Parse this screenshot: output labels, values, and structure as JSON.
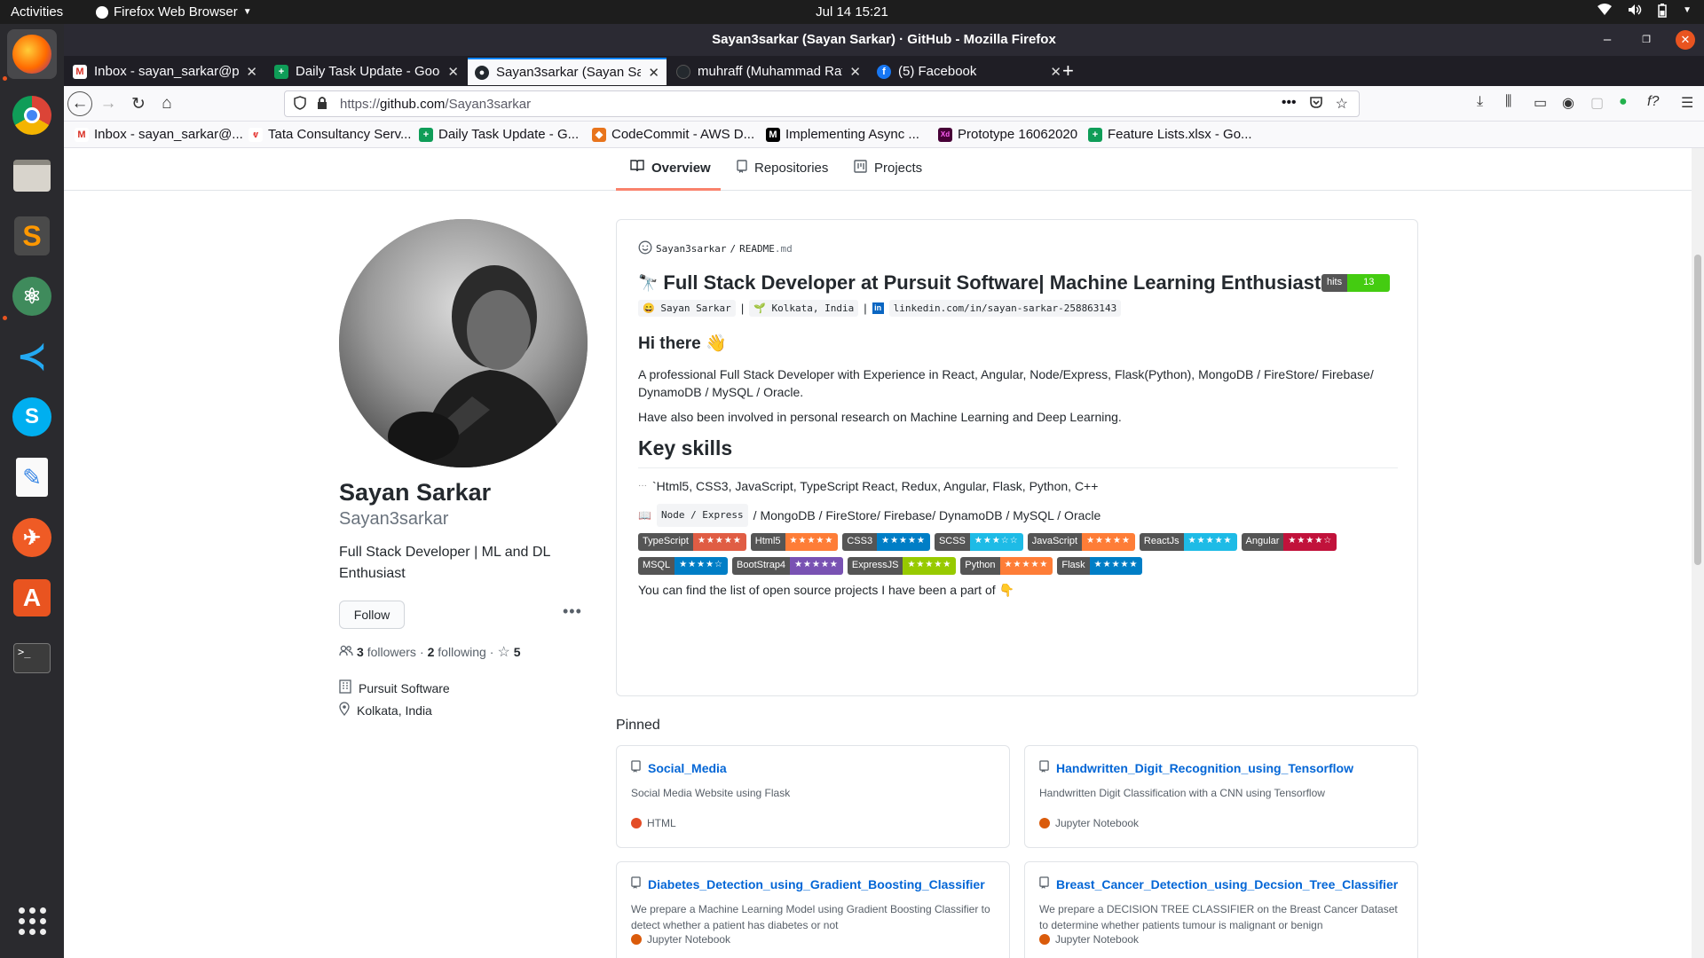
{
  "topbar": {
    "activities": "Activities",
    "app_menu": "Firefox Web Browser",
    "clock": "Jul 14  15:21"
  },
  "window": {
    "title": "Sayan3sarkar (Sayan Sarkar) · GitHub - Mozilla Firefox"
  },
  "tabs": [
    {
      "label": "Inbox - sayan_sarkar@pu",
      "icon": "gmail-icon",
      "color": "#d93025"
    },
    {
      "label": "Daily Task Update - Goog",
      "icon": "sheets-icon",
      "color": "#0f9d58"
    },
    {
      "label": "Sayan3sarkar (Sayan Sark",
      "icon": "github-icon",
      "color": "#24292e"
    },
    {
      "label": "muhraff (Muhammad Raf",
      "icon": "github-icon",
      "color": "#24292e"
    },
    {
      "label": "(5) Facebook",
      "icon": "facebook-icon",
      "color": "#1877f2"
    }
  ],
  "address_bar": {
    "url_prefix": "https://",
    "url_host": "github.com",
    "url_path": "/Sayan3sarkar"
  },
  "bookmarks": [
    {
      "label": "Inbox - sayan_sarkar@...",
      "icon": "gmail-icon",
      "color": "#d93025"
    },
    {
      "label": "Tata Consultancy Serv...",
      "icon": "tcs-icon",
      "color": "#e53935"
    },
    {
      "label": "Daily Task Update - G...",
      "icon": "sheets-icon",
      "color": "#0f9d58"
    },
    {
      "label": "CodeCommit - AWS D...",
      "icon": "aws-icon",
      "color": "#e8741c"
    },
    {
      "label": "Implementing Async ...",
      "icon": "medium-icon",
      "color": "#000000"
    },
    {
      "label": "Prototype 16062020",
      "icon": "xd-icon",
      "color": "#470137"
    },
    {
      "label": "Feature Lists.xlsx - Go...",
      "icon": "sheets-icon",
      "color": "#0f9d58"
    }
  ],
  "profile_tabs": {
    "overview": "Overview",
    "repositories": "Repositories",
    "projects": "Projects"
  },
  "profile": {
    "name": "Sayan Sarkar",
    "login": "Sayan3sarkar",
    "bio": "Full Stack Developer | ML and DL Enthusiast",
    "follow": "Follow",
    "followers_count": "3",
    "followers_label": "followers",
    "following_count": "2",
    "following_label": "following",
    "separator": "·",
    "stars": "5",
    "company": "Pursuit Software",
    "location": "Kolkata, India"
  },
  "readme": {
    "owner": "Sayan3sarkar",
    "slash": "/",
    "file": "README",
    "ext": ".md",
    "heading": "Full Stack Developer at Pursuit Software| Machine Learning Enthusiast",
    "heading_emoji": "🔭",
    "hits_label": "hits",
    "hits_value": "13",
    "name_chip": "Sayan Sarkar",
    "location_chip": "Kolkata, India",
    "linkedin_chip": "linkedin.com/in/sayan-sarkar-258863143",
    "pipe": "|",
    "hi_there": "Hi there 👋",
    "intro": "A professional Full Stack Developer with Experience in React, Angular, Node/Express, Flask(Python), MongoDB / FireStore/ Firebase/ DynamoDB / MySQL / Oracle.",
    "research": "Have also been involved in personal research on Machine Learning and Deep Learning.",
    "key_skills": "Key skills",
    "skills_line1": "`Html5, CSS3, JavaScript, TypeScript React, Redux, Angular, Flask, Python, C++",
    "skills_line2_code": "Node / Express",
    "skills_line2_rest": "/ MongoDB / FireStore/ Firebase/ DynamoDB / MySQL / Oracle",
    "badges_row1": [
      {
        "label": "TypeScript",
        "stars": "★★★★★",
        "color": "#e05d44"
      },
      {
        "label": "Html5",
        "stars": "★★★★★",
        "color": "#fe7d37"
      },
      {
        "label": "CSS3",
        "stars": "★★★★★",
        "color": "#007ec6"
      },
      {
        "label": "SCSS",
        "stars": "★★★☆☆",
        "color": "#1ebbe6"
      },
      {
        "label": "JavaScript",
        "stars": "★★★★★",
        "color": "#fe7d37"
      },
      {
        "label": "ReactJs",
        "stars": "★★★★★",
        "color": "#1ebbe6"
      },
      {
        "label": "Angular",
        "stars": "★★★★☆",
        "color": "#c1123b"
      }
    ],
    "badges_row2": [
      {
        "label": "MSQL",
        "stars": "★★★★☆",
        "color": "#007ec6"
      },
      {
        "label": "BootStrap4",
        "stars": "★★★★★",
        "color": "#7952b3"
      },
      {
        "label": "ExpressJS",
        "stars": "★★★★★",
        "color": "#97ca00"
      },
      {
        "label": "Python",
        "stars": "★★★★★",
        "color": "#fe7d37"
      },
      {
        "label": "Flask",
        "stars": "★★★★★",
        "color": "#007ec6"
      }
    ],
    "outro": "You can find the list of open source projects I have been a part of 👇"
  },
  "pinned": {
    "title": "Pinned",
    "repos": [
      {
        "name": "Social_Media",
        "desc": "Social Media Website using Flask",
        "lang": "HTML",
        "lang_color": "#e34c26"
      },
      {
        "name": "Handwritten_Digit_Recognition_using_Tensorflow",
        "desc": "Handwritten Digit Classification with a CNN using Tensorflow",
        "lang": "Jupyter Notebook",
        "lang_color": "#da5b0b"
      },
      {
        "name": "Diabetes_Detection_using_Gradient_Boosting_Classifier",
        "desc": "We prepare a Machine Learning Model using Gradient Boosting Classifier to detect whether a patient has diabetes or not",
        "lang": "Jupyter Notebook",
        "lang_color": "#da5b0b"
      },
      {
        "name": "Breast_Cancer_Detection_using_Decsion_Tree_Classifier",
        "desc": "We prepare a DECISION TREE CLASSIFIER on the Breast Cancer Dataset to determine whether patients tumour is malignant or benign",
        "lang": "Jupyter Notebook",
        "lang_color": "#da5b0b"
      }
    ]
  }
}
